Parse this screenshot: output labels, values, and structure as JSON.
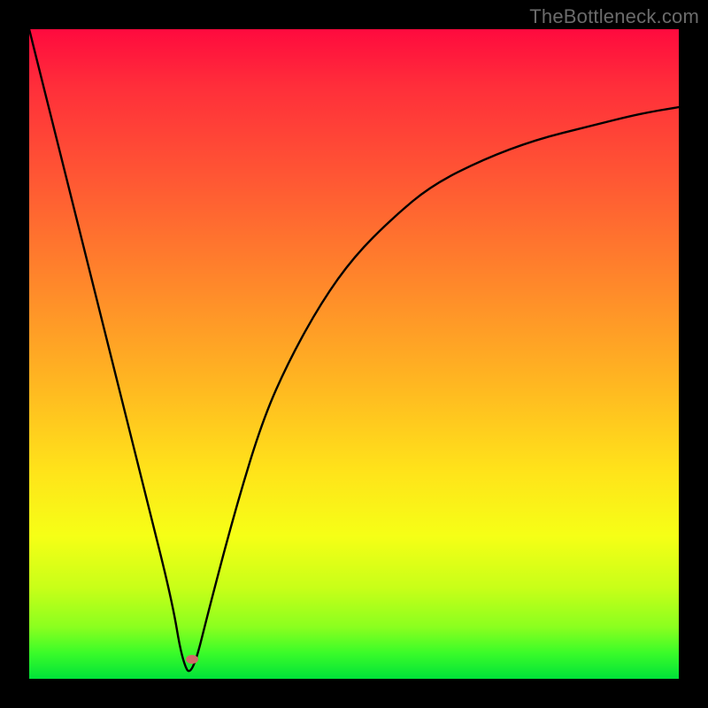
{
  "attribution": "TheBottleneck.com",
  "chart_data": {
    "type": "line",
    "title": "",
    "xlabel": "",
    "ylabel": "",
    "xlim": [
      0,
      100
    ],
    "ylim": [
      0,
      100
    ],
    "series": [
      {
        "name": "curve",
        "x": [
          0,
          5,
          10,
          14,
          18,
          22,
          23.5,
          25,
          28,
          32,
          36,
          40,
          45,
          50,
          56,
          62,
          70,
          78,
          86,
          94,
          100
        ],
        "values": [
          100,
          80,
          60,
          44,
          28,
          12,
          3,
          0,
          12,
          27,
          40,
          49,
          58,
          65,
          71,
          76,
          80,
          83,
          85,
          87,
          88
        ]
      }
    ],
    "marker": {
      "x": 25,
      "y": 3
    },
    "gradient_stops": [
      {
        "pos": 0,
        "color": "#ff0a3e"
      },
      {
        "pos": 9,
        "color": "#ff2f3a"
      },
      {
        "pos": 24,
        "color": "#ff5a33"
      },
      {
        "pos": 40,
        "color": "#ff8a2a"
      },
      {
        "pos": 55,
        "color": "#ffb821"
      },
      {
        "pos": 68,
        "color": "#ffe31a"
      },
      {
        "pos": 78,
        "color": "#f6ff16"
      },
      {
        "pos": 86,
        "color": "#c8ff18"
      },
      {
        "pos": 92,
        "color": "#8bff1f"
      },
      {
        "pos": 96,
        "color": "#3bfc29"
      },
      {
        "pos": 100,
        "color": "#00e239"
      }
    ]
  }
}
